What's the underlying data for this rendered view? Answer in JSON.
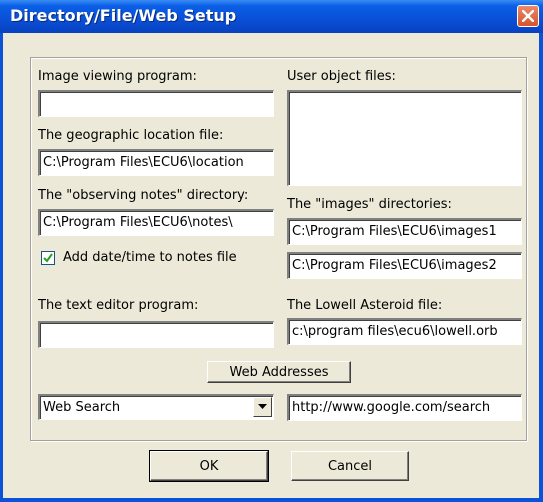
{
  "window": {
    "title": "Directory/File/Web Setup"
  },
  "left": {
    "image_viewer_label": "Image viewing program:",
    "image_viewer_value": "",
    "geo_label": "The geographic location file:",
    "geo_value": "C:\\Program Files\\ECU6\\location",
    "notes_label": "The \"observing notes\" directory:",
    "notes_value": "C:\\Program Files\\ECU6\\notes\\",
    "add_datetime_label": "Add date/time to notes file",
    "add_datetime_checked": true,
    "text_editor_label": "The text editor program:",
    "text_editor_value": ""
  },
  "right": {
    "user_object_label": "User object files:",
    "images_label": "The \"images\" directories:",
    "images_dir_1": "C:\\Program Files\\ECU6\\images1",
    "images_dir_2": "C:\\Program Files\\ECU6\\images2",
    "lowell_label": "The Lowell Asteroid file:",
    "lowell_value": "c:\\program files\\ecu6\\lowell.orb"
  },
  "web": {
    "button_label": "Web Addresses",
    "select_value": "Web Search",
    "url_value": "http://www.google.com/search"
  },
  "buttons": {
    "ok": "OK",
    "cancel": "Cancel"
  }
}
